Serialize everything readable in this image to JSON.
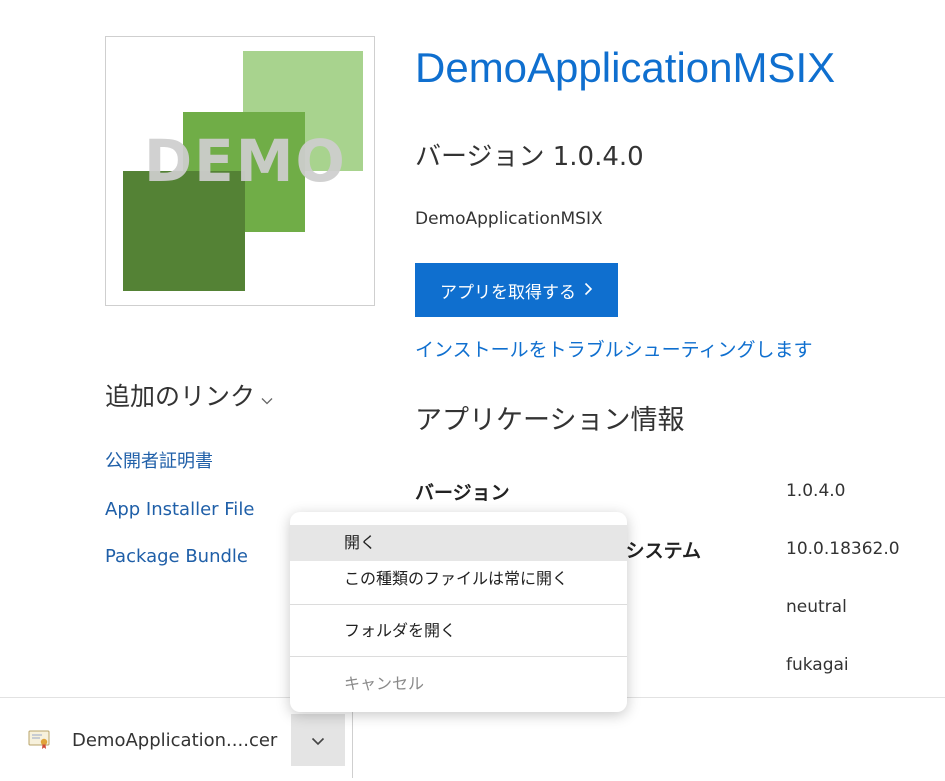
{
  "app": {
    "logo_text": "DEMO",
    "title": "DemoApplicationMSIX",
    "version_heading": "バージョン 1.0.4.0",
    "publisher": "DemoApplicationMSIX",
    "get_button_label": "アプリを取得する",
    "troubleshoot_link": "インストールをトラブルシューティングします",
    "info_heading": "アプリケーション情報"
  },
  "info_rows": [
    {
      "label": "バージョン",
      "value": "1.0.4.0"
    },
    {
      "label": "ブ システム",
      "value": "10.0.18362.0"
    },
    {
      "label": "",
      "value": "neutral"
    },
    {
      "label": "",
      "value": "fukagai"
    }
  ],
  "links": {
    "heading": "追加のリンク",
    "items": [
      "公開者証明書",
      "App Installer File",
      "Package Bundle"
    ]
  },
  "context_menu": {
    "items": [
      "開く",
      "この種類のファイルは常に開く",
      "フォルダを開く",
      "キャンセル"
    ]
  },
  "download": {
    "file_name": "DemoApplication....cer"
  },
  "colors": {
    "accent": "#0f6fcf",
    "link": "#1f5fa8",
    "logo_light": "#a8d38e",
    "logo_mid": "#70ad47",
    "logo_dark": "#548235"
  }
}
